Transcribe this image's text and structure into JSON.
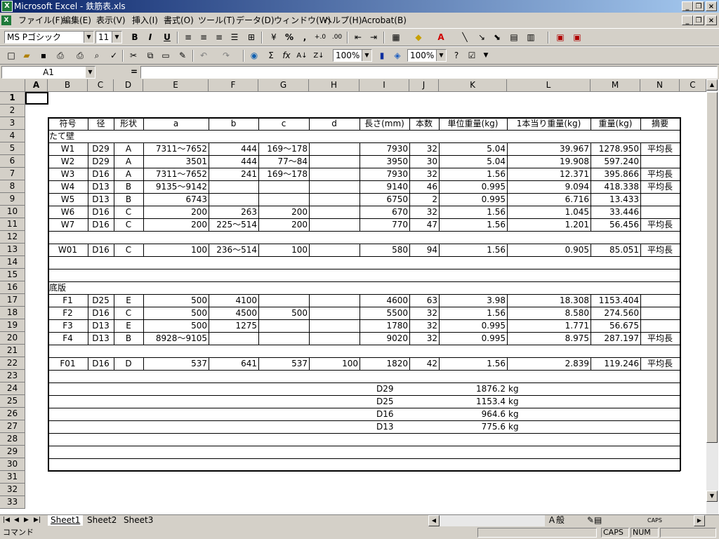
{
  "window": {
    "title": "Microsoft Excel - 鉄筋表.xls",
    "minimize": "_",
    "restore": "❐",
    "close": "×"
  },
  "menu": [
    "ファイル(F)",
    "編集(E)",
    "表示(V)",
    "挿入(I)",
    "書式(O)",
    "ツール(T)",
    "データ(D)",
    "ウィンドウ(W)",
    "ヘルプ(H)",
    "Acrobat(B)"
  ],
  "toolbar": {
    "font_name": "MS Pゴシック",
    "font_size": "11",
    "zoom1": "100%",
    "zoom2": "100%"
  },
  "formula": {
    "name_box": "A1",
    "equals": "=",
    "content": ""
  },
  "columns": [
    "A",
    "B",
    "C",
    "D",
    "E",
    "F",
    "G",
    "H",
    "I",
    "J",
    "K",
    "L",
    "M",
    "N",
    "C"
  ],
  "rows": [
    "1",
    "2",
    "3",
    "4",
    "5",
    "6",
    "7",
    "8",
    "9",
    "10",
    "11",
    "12",
    "13",
    "14",
    "15",
    "16",
    "17",
    "18",
    "19",
    "20",
    "21",
    "22",
    "23",
    "24",
    "25",
    "26",
    "27",
    "28",
    "29",
    "30",
    "31",
    "32",
    "33"
  ],
  "table": {
    "headers": [
      "符号",
      "径",
      "形状",
      "a",
      "b",
      "c",
      "d",
      "長さ(mm)",
      "本数",
      "単位重量(kg)",
      "1本当り重量(kg)",
      "重量(kg)",
      "摘要"
    ],
    "section_wall": "たて壁",
    "section_base": "底版",
    "wall_rows": [
      [
        "W1",
        "D29",
        "A",
        "7311～7652",
        "444",
        "169～178",
        "",
        "7930",
        "32",
        "5.04",
        "39.967",
        "1278.950",
        "平均長"
      ],
      [
        "W2",
        "D29",
        "A",
        "3501",
        "444",
        "77～84",
        "",
        "3950",
        "30",
        "5.04",
        "19.908",
        "597.240",
        ""
      ],
      [
        "W3",
        "D16",
        "A",
        "7311～7652",
        "241",
        "169～178",
        "",
        "7930",
        "32",
        "1.56",
        "12.371",
        "395.866",
        "平均長"
      ],
      [
        "W4",
        "D13",
        "B",
        "9135～9142",
        "",
        "",
        "",
        "9140",
        "46",
        "0.995",
        "9.094",
        "418.338",
        "平均長"
      ],
      [
        "W5",
        "D13",
        "B",
        "6743",
        "",
        "",
        "",
        "6750",
        "2",
        "0.995",
        "6.716",
        "13.433",
        ""
      ],
      [
        "W6",
        "D16",
        "C",
        "200",
        "263",
        "200",
        "",
        "670",
        "32",
        "1.56",
        "1.045",
        "33.446",
        ""
      ],
      [
        "W7",
        "D16",
        "C",
        "200",
        "225～514",
        "200",
        "",
        "770",
        "47",
        "1.56",
        "1.201",
        "56.456",
        "平均長"
      ]
    ],
    "wall_extra": [
      "W01",
      "D16",
      "C",
      "100",
      "236～514",
      "100",
      "",
      "580",
      "94",
      "1.56",
      "0.905",
      "85.051",
      "平均長"
    ],
    "base_rows": [
      [
        "F1",
        "D25",
        "E",
        "500",
        "4100",
        "",
        "",
        "4600",
        "63",
        "3.98",
        "18.308",
        "1153.404",
        ""
      ],
      [
        "F2",
        "D16",
        "C",
        "500",
        "4500",
        "500",
        "",
        "5500",
        "32",
        "1.56",
        "8.580",
        "274.560",
        ""
      ],
      [
        "F3",
        "D13",
        "E",
        "500",
        "1275",
        "",
        "",
        "1780",
        "32",
        "0.995",
        "1.771",
        "56.675",
        ""
      ],
      [
        "F4",
        "D13",
        "B",
        "8928～9105",
        "",
        "",
        "",
        "9020",
        "32",
        "0.995",
        "8.975",
        "287.197",
        "平均長"
      ]
    ],
    "base_extra": [
      "F01",
      "D16",
      "D",
      "537",
      "641",
      "537",
      "100",
      "1820",
      "42",
      "1.56",
      "2.839",
      "119.246",
      "平均長"
    ],
    "summary": [
      {
        "dia": "D29",
        "weight": "1876.2",
        "unit": "kg"
      },
      {
        "dia": "D25",
        "weight": "1153.4",
        "unit": "kg"
      },
      {
        "dia": "D16",
        "weight": "964.6",
        "unit": "kg"
      },
      {
        "dia": "D13",
        "weight": "775.6",
        "unit": "kg"
      }
    ]
  },
  "sheets": [
    "Sheet1",
    "Sheet2",
    "Sheet3"
  ],
  "status": {
    "mode": "コマンド",
    "caps": "CAPS",
    "num": "NUM"
  }
}
